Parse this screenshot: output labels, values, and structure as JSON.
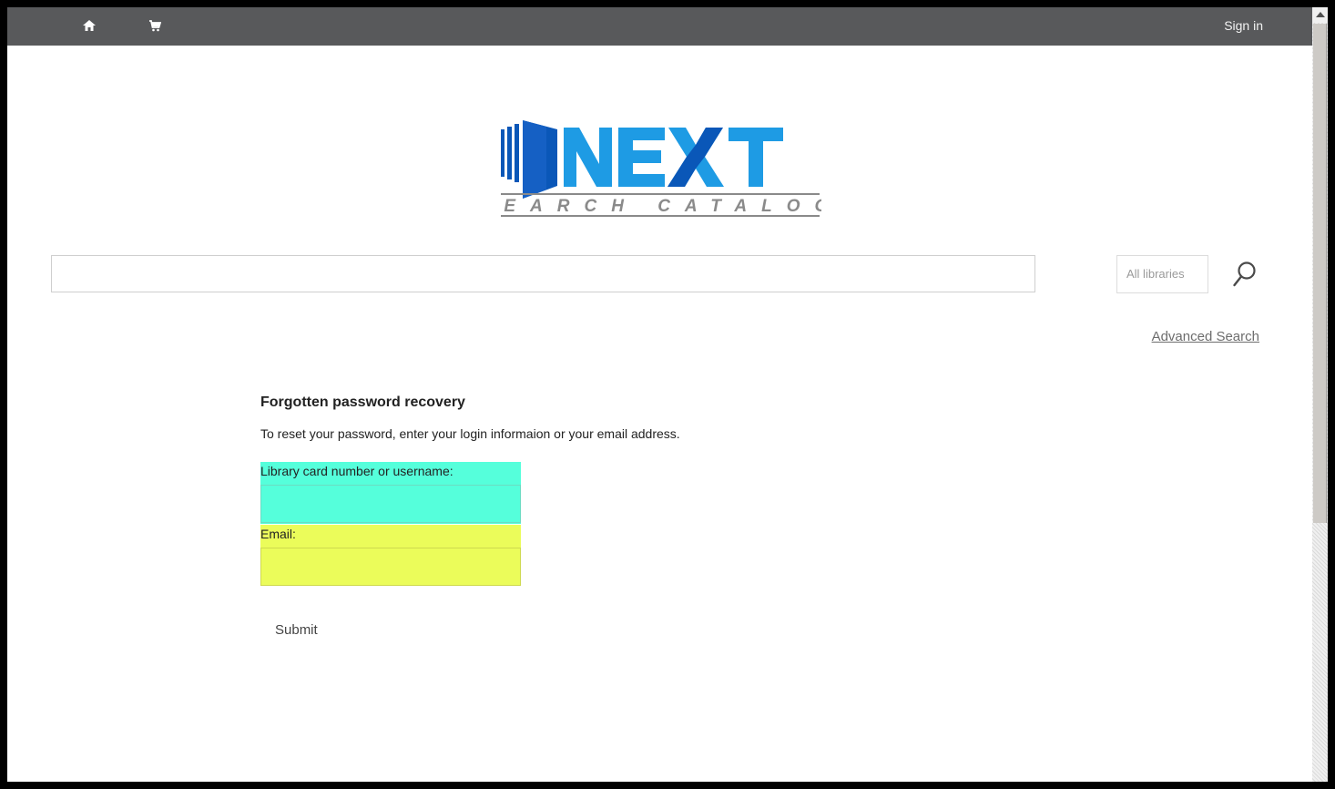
{
  "topbar": {
    "home_icon": "home-icon",
    "cart_icon": "cart-icon",
    "signin_label": "Sign in"
  },
  "logo": {
    "word": "NEXT",
    "tagline": "SEARCH CATALOG",
    "colors": {
      "primary": "#1e9be4",
      "dark": "#0a57b8",
      "gray": "#8a8a8a"
    }
  },
  "search": {
    "query": "",
    "library_selected": "All libraries",
    "search_icon": "search-icon",
    "advanced_label": "Advanced Search"
  },
  "form": {
    "title": "Forgotten password recovery",
    "description": "To reset your password, enter your login informaion or your email address.",
    "username_label": "Library card number or username:",
    "username_value": "",
    "email_label": "Email:",
    "email_value": "",
    "submit_label": "Submit"
  },
  "colors": {
    "topbar": "#58595b",
    "username_highlight": "#55ffdb",
    "email_highlight": "#ebfc5a"
  }
}
